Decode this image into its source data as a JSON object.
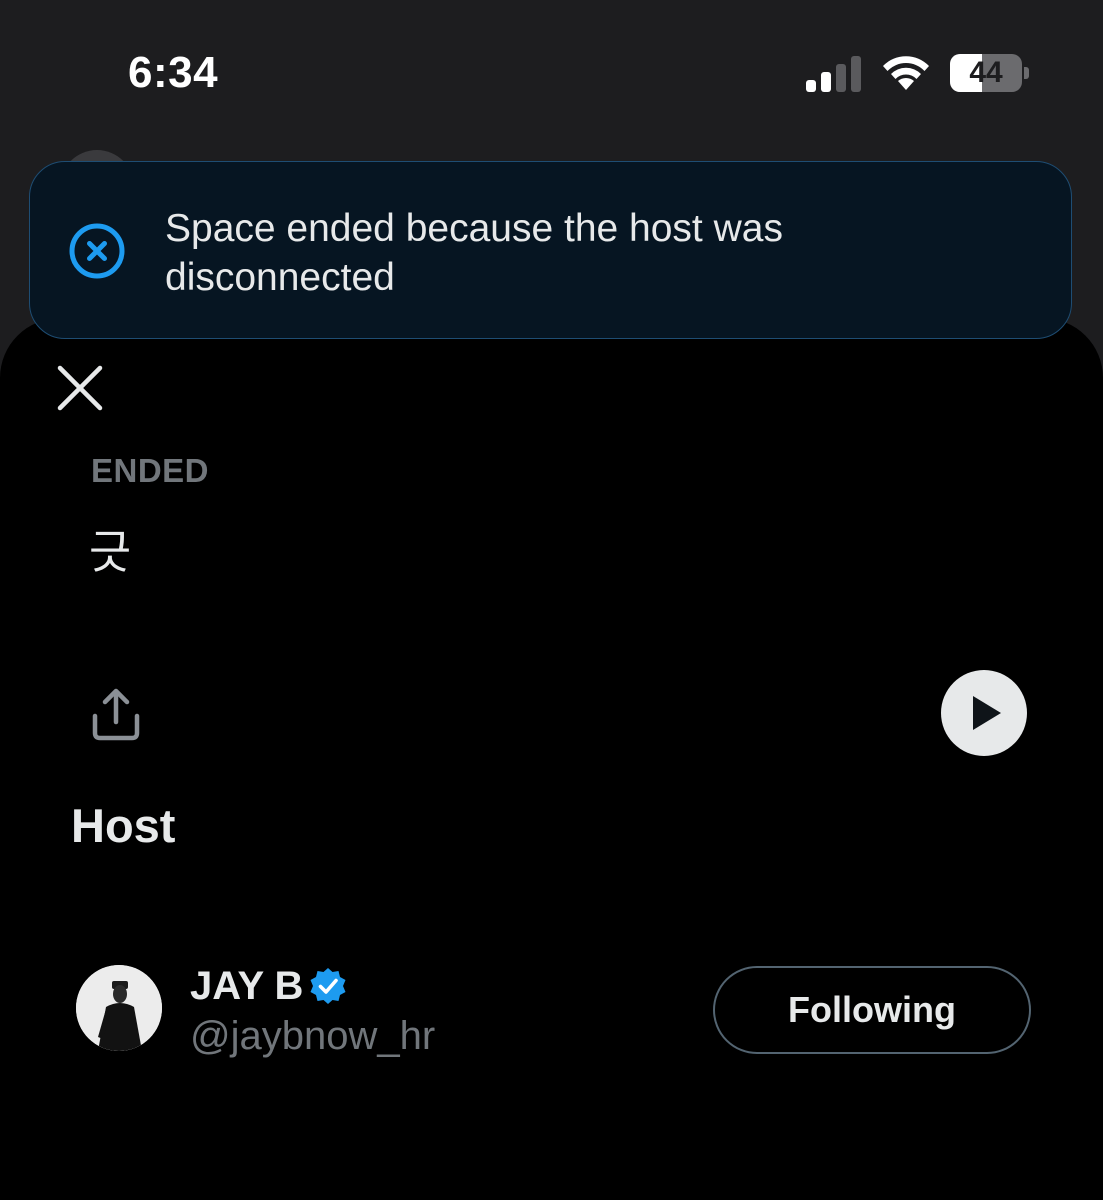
{
  "status_bar": {
    "time": "6:34",
    "battery_level": "44",
    "battery_fraction": 0.44
  },
  "toast": {
    "message": "Space ended because the host was disconnected",
    "icon": "close-circle-icon",
    "accent_color": "#1d9bf0"
  },
  "space": {
    "status": "ENDED",
    "title": "긋"
  },
  "host_section": {
    "heading": "Host",
    "host": {
      "name": "JAY B",
      "handle": "@jaybnow_hr",
      "verified": true,
      "follow_label": "Following"
    }
  },
  "icons": {
    "close": "close-icon",
    "share": "share-icon",
    "play": "play-icon",
    "verified": "verified-badge-icon"
  }
}
